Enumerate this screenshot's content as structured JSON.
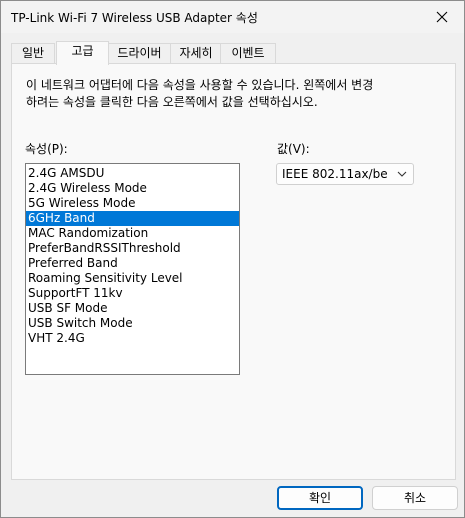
{
  "window": {
    "title": "TP-Link Wi-Fi 7 Wireless USB Adapter 속성"
  },
  "tabs": [
    {
      "label": "일반"
    },
    {
      "label": "고급"
    },
    {
      "label": "드라이버"
    },
    {
      "label": "자세히"
    },
    {
      "label": "이벤트"
    }
  ],
  "active_tab": "고급",
  "advanced": {
    "description": "이 네트워크 어댑터에 다음 속성을 사용할 수 있습니다. 왼쪽에서 변경\n하려는 속성을 클릭한 다음 오른쪽에서 값을 선택하십시오.",
    "property_label": "속성(P):",
    "value_label": "값(V):",
    "properties": [
      "2.4G AMSDU",
      "2.4G Wireless Mode",
      "5G Wireless Mode",
      "6GHz Band",
      "MAC Randomization",
      "PreferBandRSSIThreshold",
      "Preferred Band",
      "Roaming Sensitivity Level",
      "SupportFT 11kv",
      "USB SF Mode",
      "USB Switch Mode",
      "VHT 2.4G"
    ],
    "selected_property": "6GHz Band",
    "value_selected": "IEEE 802.11ax/be"
  },
  "buttons": {
    "ok": "확인",
    "cancel": "취소"
  },
  "colors": {
    "selection": "#0078d7",
    "primary_border": "#0067c0"
  },
  "icons": {
    "close": "close-icon",
    "dropdown": "chevron-down-icon"
  }
}
